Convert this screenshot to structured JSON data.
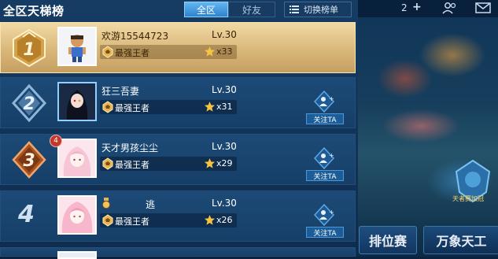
{
  "header": {
    "title": "全区天梯榜",
    "tabs": [
      {
        "label": "全区",
        "active": true
      },
      {
        "label": "好友",
        "active": false
      }
    ],
    "switch_label": "切换榜单"
  },
  "topbar": {
    "count": "2"
  },
  "bottom_buttons": {
    "rank": "排位赛",
    "wanxiang": "万象天工"
  },
  "event_label": "天者赛加冠",
  "rows": [
    {
      "rank": "1",
      "name": "欢游15544723",
      "level": "Lv.30",
      "tier": "最强王者",
      "stars": "x33"
    },
    {
      "rank": "2",
      "name": "狂三吾妻",
      "level": "Lv.30",
      "tier": "最强王者",
      "stars": "x31",
      "follow": "关注TA"
    },
    {
      "rank": "3",
      "name": "天才男孩尘尘",
      "level": "Lv.30",
      "tier": "最强王者",
      "stars": "x29",
      "follow": "关注TA",
      "badge": "4"
    },
    {
      "rank": "4",
      "name": "逃",
      "level": "Lv.30",
      "tier": "最强王者",
      "stars": "x26",
      "follow": "关注TA"
    }
  ],
  "colors": {
    "accent": "#62b6f1",
    "gold": "#e7b451",
    "panel": "#163c63"
  }
}
